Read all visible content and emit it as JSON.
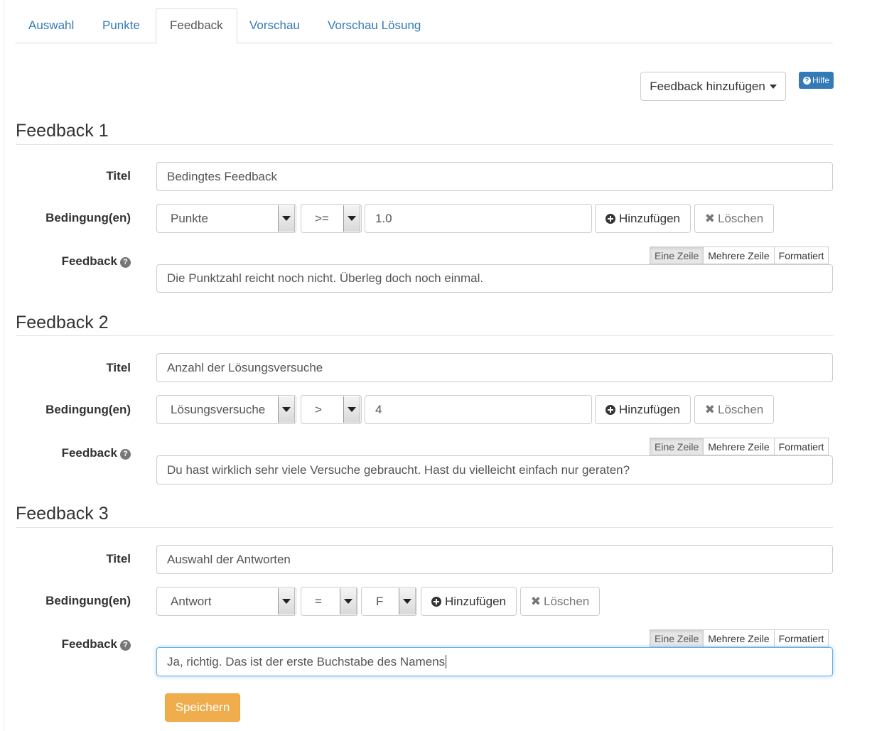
{
  "tabs": [
    "Auswahl",
    "Punkte",
    "Feedback",
    "Vorschau",
    "Vorschau Lösung"
  ],
  "active_tab": "Feedback",
  "toolbar": {
    "add_feedback_label": "Feedback hinzufügen",
    "help_label": "Hilfe"
  },
  "labels": {
    "title": "Titel",
    "conditions": "Bedingung(en)",
    "feedback": "Feedback"
  },
  "buttons": {
    "add": "Hinzufügen",
    "delete": "Löschen",
    "save": "Speichern"
  },
  "modes": [
    "Eine Zeile",
    "Mehrere Zeile",
    "Formatiert"
  ],
  "feedbacks": [
    {
      "heading": "Feedback 1",
      "title": "Bedingtes Feedback",
      "variable": "Punkte",
      "operator": ">=",
      "value": "1.0",
      "feedback_text": "Die Punktzahl reicht noch nicht. Überleg doch noch einmal.",
      "active_mode": "Eine Zeile"
    },
    {
      "heading": "Feedback 2",
      "title": "Anzahl der Lösungsversuche",
      "variable": "Lösungsversuche",
      "operator": ">",
      "value": "4",
      "feedback_text": "Du hast wirklich sehr viele Versuche gebraucht. Hast du vielleicht einfach nur geraten?",
      "active_mode": "Eine Zeile"
    },
    {
      "heading": "Feedback 3",
      "title": "Auswahl der Antworten",
      "variable": "Antwort",
      "operator": "=",
      "value": "F",
      "feedback_text": "Ja, richtig. Das ist der erste Buchstabe des Namens",
      "active_mode": "Eine Zeile"
    }
  ],
  "colors": {
    "link": "#337ab7",
    "save_button": "#f0ad4e",
    "help_button": "#337ab7"
  }
}
